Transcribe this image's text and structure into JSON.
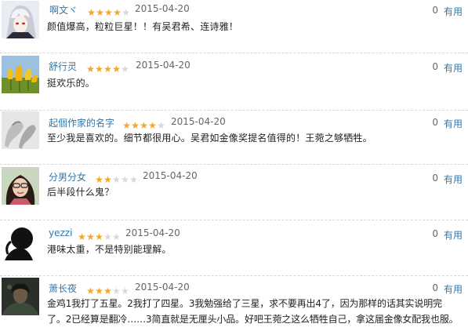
{
  "useful_label": "有用",
  "reviews": [
    {
      "name": "啊文ヾ",
      "stars": 4,
      "date": "2015-04-20",
      "votes": "0",
      "text": "颜值爆高，粒粒巨星！！有吴君希、连诗雅！",
      "avatar": "anime-avatar"
    },
    {
      "name": "舒行灵",
      "stars": 4,
      "date": "2015-04-20",
      "votes": "0",
      "text": "挺欢乐的。",
      "avatar": "tulips-avatar"
    },
    {
      "name": "起個作家的名字",
      "stars": 4,
      "date": "2015-04-20",
      "votes": "0",
      "text": "至少我是喜欢的。细节都很用心。吴君如金像奖提名值得的！王菀之够牺牲。",
      "avatar": "hands-avatar"
    },
    {
      "name": "分男分女",
      "stars": 2,
      "date": "2015-04-20",
      "votes": "0",
      "text": "后半段什么鬼？",
      "avatar": "woman-avatar"
    },
    {
      "name": "yezzi",
      "stars": 3,
      "date": "2015-04-20",
      "votes": "0",
      "text": "港味太重，不是特别能理解。",
      "avatar": "silhouette-avatar"
    },
    {
      "name": "萧长夜",
      "stars": 3,
      "date": "2015-04-20",
      "votes": "0",
      "text": "金鸡1我打了五星。2我打了四星。3我勉强给了三星，求不要再出4了，因为那样的话其实说明完",
      "text2": "了。2已经算是翻冷……3简直就是无厘头小品。好吧王菀之这么牺牲自己，拿这届金像女配我也服。",
      "avatar": "dark-avatar"
    }
  ],
  "colors": {
    "link": "#3377aa",
    "star_on": "#f5a623",
    "star_off": "#d8d8d8"
  }
}
